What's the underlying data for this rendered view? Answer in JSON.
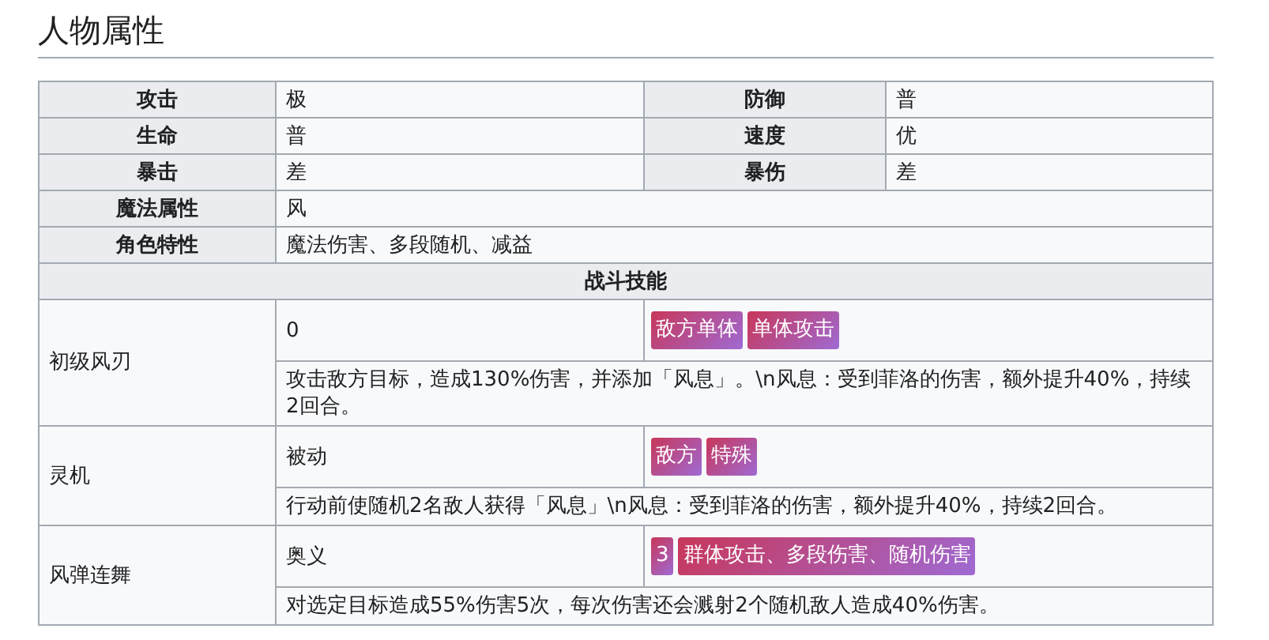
{
  "title": "人物属性",
  "stats": [
    [
      {
        "label": "攻击",
        "value": "极"
      },
      {
        "label": "防御",
        "value": "普"
      }
    ],
    [
      {
        "label": "生命",
        "value": "普"
      },
      {
        "label": "速度",
        "value": "优"
      }
    ],
    [
      {
        "label": "暴击",
        "value": "差"
      },
      {
        "label": "暴伤",
        "value": "差"
      }
    ]
  ],
  "attributes": [
    {
      "label": "魔法属性",
      "value": "风"
    },
    {
      "label": "角色特性",
      "value": "魔法伤害、多段随机、减益"
    }
  ],
  "skills_header": "战斗技能",
  "skills": [
    {
      "name": "初级风刃",
      "type": "0",
      "tags": [
        "敌方单体",
        "单体攻击"
      ],
      "description": "攻击敌方目标，造成130%伤害，并添加「风息」。\\n风息：受到菲洛的伤害，额外提升40%，持续2回合。"
    },
    {
      "name": "灵机",
      "type": "被动",
      "tags": [
        "敌方",
        "特殊"
      ],
      "description": "行动前使随机2名敌人获得「风息」\\n风息：受到菲洛的伤害，额外提升40%，持续2回合。"
    },
    {
      "name": "风弹连舞",
      "type": "奥义",
      "tags": [
        "3",
        "群体攻击、多段伤害、随机伤害"
      ],
      "description": "对选定目标造成55%伤害5次，每次伤害还会溅射2个随机敌人造成40%伤害。"
    }
  ]
}
